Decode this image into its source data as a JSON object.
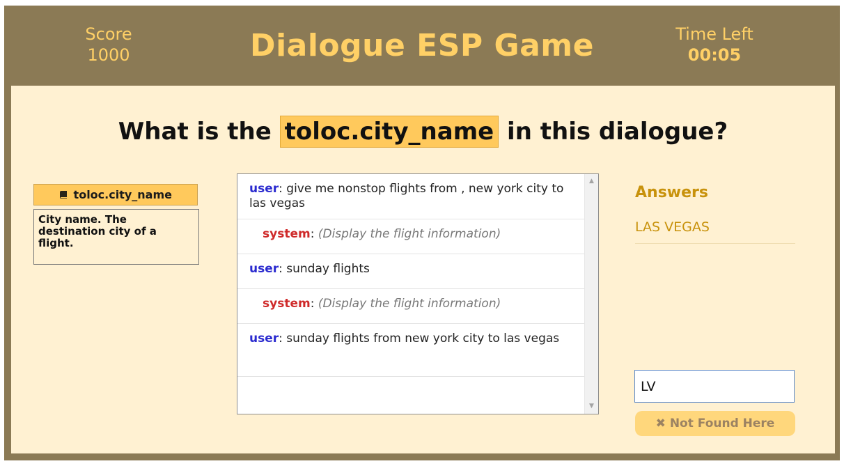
{
  "header": {
    "score_label": "Score",
    "score_value": "1000",
    "title": "Dialogue ESP Game",
    "time_label": "Time Left",
    "time_value": "00:05"
  },
  "question": {
    "prefix": "What is the",
    "slot": "toloc.city_name",
    "suffix": "in this dialogue?"
  },
  "slot_info": {
    "icon": "book-icon",
    "name": "toloc.city_name",
    "description": "City name. The destination city of a flight."
  },
  "dialogue": {
    "turns": [
      {
        "speaker": "user",
        "text": "give me nonstop flights from , new york city to las vegas"
      },
      {
        "speaker": "system",
        "text": "(Display the flight information)"
      },
      {
        "speaker": "user",
        "text": "sunday flights"
      },
      {
        "speaker": "system",
        "text": "(Display the flight information)"
      },
      {
        "speaker": "user",
        "text": "sunday flights from new york city to las vegas"
      }
    ],
    "speaker_colors": {
      "user": "#2a2acf",
      "system": "#cf2a2a"
    }
  },
  "answers": {
    "heading": "Answers",
    "items": [
      "LAS VEGAS"
    ],
    "input_value": "LV",
    "not_found_label": "Not Found Here",
    "not_found_icon": "close-icon"
  },
  "colors": {
    "frame": "#8b7a55",
    "panel": "#fff1d2",
    "accent": "#ffc95c",
    "answer_text": "#c8920c"
  }
}
